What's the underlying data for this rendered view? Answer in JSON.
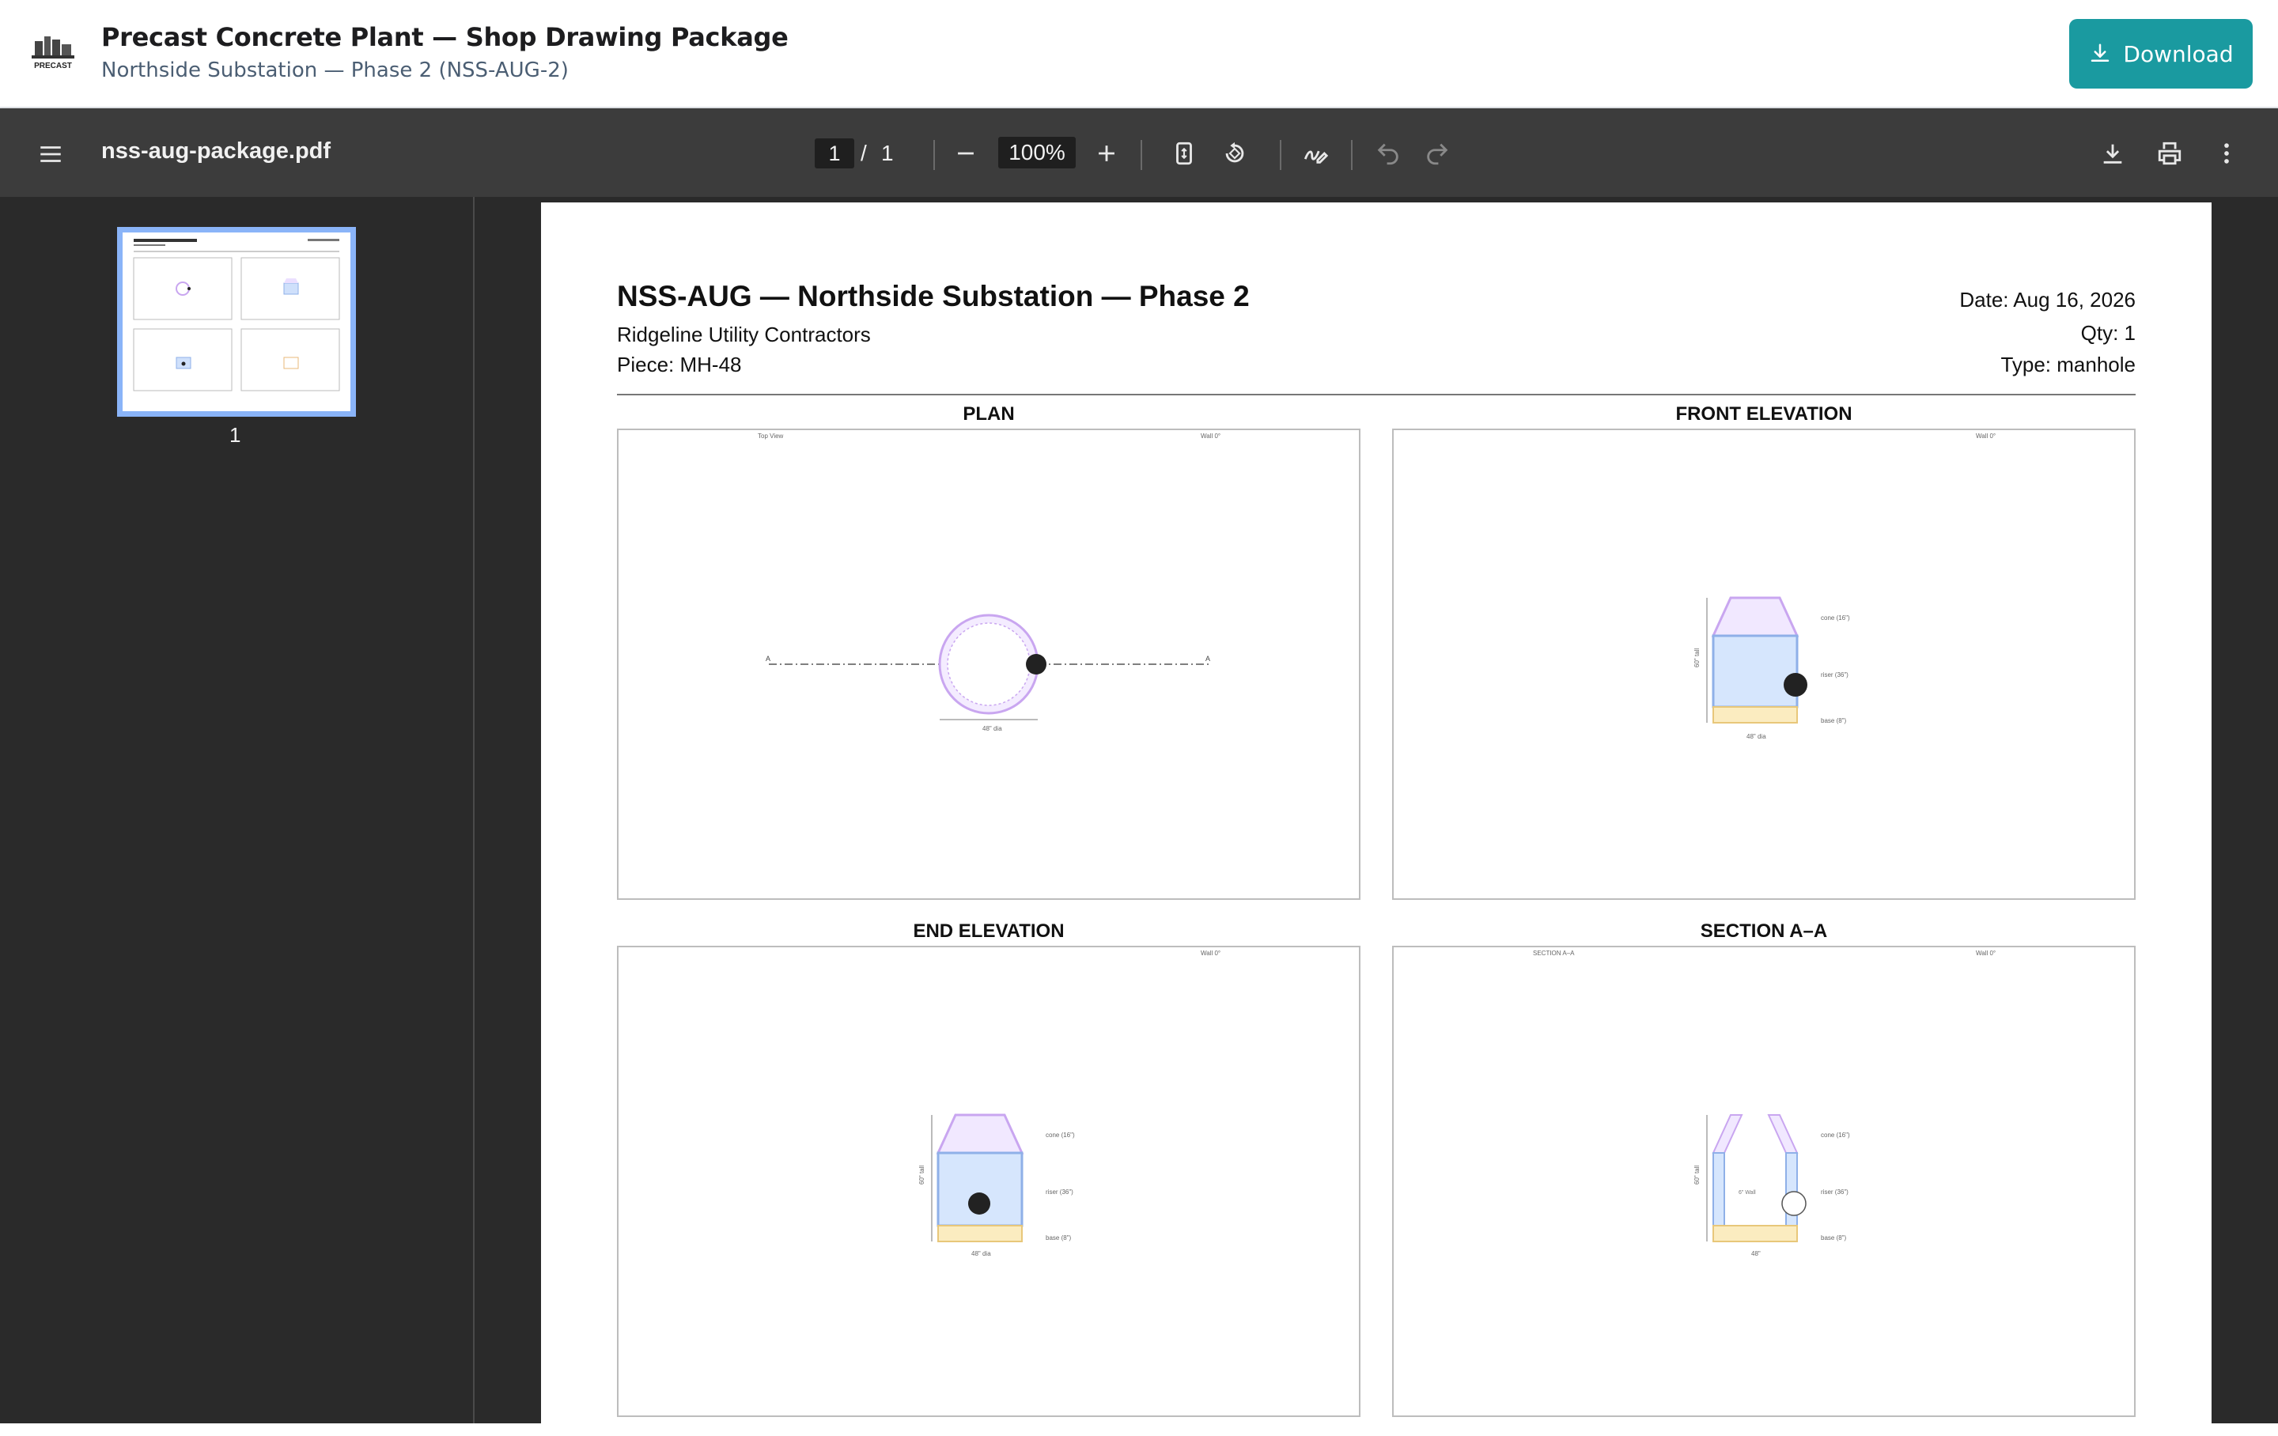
{
  "app": {
    "title": "Precast Concrete Plant — Shop Drawing Package",
    "subtitle": "Northside Substation — Phase 2 (NSS-AUG-2)",
    "download_label": "Download",
    "logo_text": "PRECAST",
    "accent_color": "#1a9aa0"
  },
  "viewer": {
    "file_name": "nss-aug-package.pdf",
    "page_current": "1",
    "page_sep": "/",
    "page_total": "1",
    "zoom": "100%",
    "icons": [
      "menu-icon",
      "zoom-out-icon",
      "zoom-in-icon",
      "fit-page-icon",
      "rotate-icon",
      "annotate-icon",
      "undo-icon",
      "redo-icon",
      "download-icon",
      "print-icon",
      "more-icon"
    ]
  },
  "sidebar": {
    "thumbnails": [
      {
        "page_label": "1"
      }
    ]
  },
  "sheet": {
    "title": "NSS-AUG — Northside Substation — Phase 2",
    "client": "Ridgeline Utility Contractors",
    "piece": "Piece: MH-48",
    "date": "Date: Aug 16, 2026",
    "qty": "Qty: 1",
    "type": "Type: manhole",
    "views": [
      {
        "label": "PLAN",
        "tag_left": "Top View",
        "tag_right": "Wall 0°",
        "dim": "48\" dia",
        "mark_a": "A"
      },
      {
        "label": "FRONT ELEVATION",
        "tag_right": "Wall 0°",
        "dim": "48\" dia",
        "cone": "cone (16\")",
        "riser": "riser (36\")",
        "base": "base (8\")",
        "height": "60\" tall"
      },
      {
        "label": "END ELEVATION",
        "tag_right": "Wall 0°",
        "dim": "48\" dia",
        "cone": "cone (16\")",
        "riser": "riser (36\")",
        "base": "base (8\")",
        "height": "60\" tall"
      },
      {
        "label": "SECTION A–A",
        "tag_left": "SECTION A–A",
        "tag_right": "Wall 0°",
        "dim": "48\"",
        "cone": "cone (16\")",
        "riser": "riser (36\")",
        "base": "base (8\")",
        "height": "60\" tall",
        "wall": "6\" Wall"
      }
    ]
  }
}
